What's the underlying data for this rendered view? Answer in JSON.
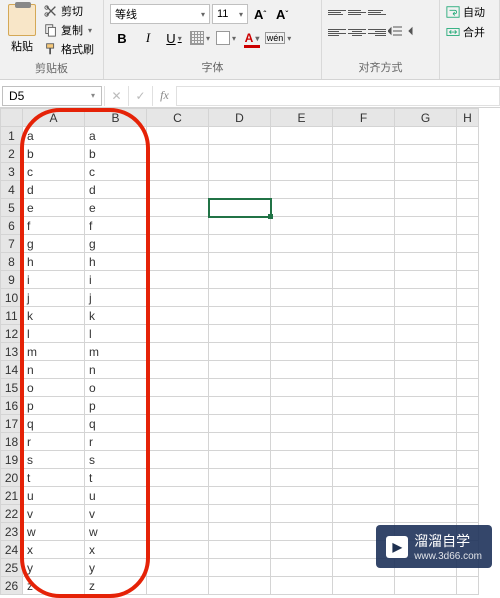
{
  "ribbon": {
    "clipboard": {
      "paste": "粘贴",
      "cut": "剪切",
      "copy": "复制",
      "format_painter": "格式刷",
      "title": "剪贴板"
    },
    "font": {
      "font_name": "等线",
      "font_size": "11",
      "title": "字体",
      "bold": "B",
      "italic": "I",
      "underline": "U",
      "a_big": "A",
      "a_small": "A",
      "font_color": "A",
      "wen": "wén"
    },
    "alignment": {
      "title": "对齐方式"
    },
    "right": {
      "auto": "自动",
      "merge": "合并"
    }
  },
  "name_box": "D5",
  "formula": "",
  "columns": [
    "A",
    "B",
    "C",
    "D",
    "E",
    "F",
    "G",
    "H"
  ],
  "rows": [
    {
      "n": 1,
      "A": "a",
      "B": "a"
    },
    {
      "n": 2,
      "A": "b",
      "B": "b"
    },
    {
      "n": 3,
      "A": "c",
      "B": "c"
    },
    {
      "n": 4,
      "A": "d",
      "B": "d"
    },
    {
      "n": 5,
      "A": "e",
      "B": "e"
    },
    {
      "n": 6,
      "A": "f",
      "B": "f"
    },
    {
      "n": 7,
      "A": "g",
      "B": "g"
    },
    {
      "n": 8,
      "A": "h",
      "B": "h"
    },
    {
      "n": 9,
      "A": "i",
      "B": "i"
    },
    {
      "n": 10,
      "A": "j",
      "B": "j"
    },
    {
      "n": 11,
      "A": "k",
      "B": "k"
    },
    {
      "n": 12,
      "A": "l",
      "B": "l"
    },
    {
      "n": 13,
      "A": "m",
      "B": "m"
    },
    {
      "n": 14,
      "A": "n",
      "B": "n"
    },
    {
      "n": 15,
      "A": "o",
      "B": "o"
    },
    {
      "n": 16,
      "A": "p",
      "B": "p"
    },
    {
      "n": 17,
      "A": "q",
      "B": "q"
    },
    {
      "n": 18,
      "A": "r",
      "B": "r"
    },
    {
      "n": 19,
      "A": "s",
      "B": "s"
    },
    {
      "n": 20,
      "A": "t",
      "B": "t"
    },
    {
      "n": 21,
      "A": "u",
      "B": "u"
    },
    {
      "n": 22,
      "A": "v",
      "B": "v"
    },
    {
      "n": 23,
      "A": "w",
      "B": "w"
    },
    {
      "n": 24,
      "A": "x",
      "B": "x"
    },
    {
      "n": 25,
      "A": "y",
      "B": "y"
    },
    {
      "n": 26,
      "A": "z",
      "B": "z"
    }
  ],
  "selected_cell": "D5",
  "watermark": {
    "brand": "溜溜自学",
    "url": "www.3d66.com"
  }
}
